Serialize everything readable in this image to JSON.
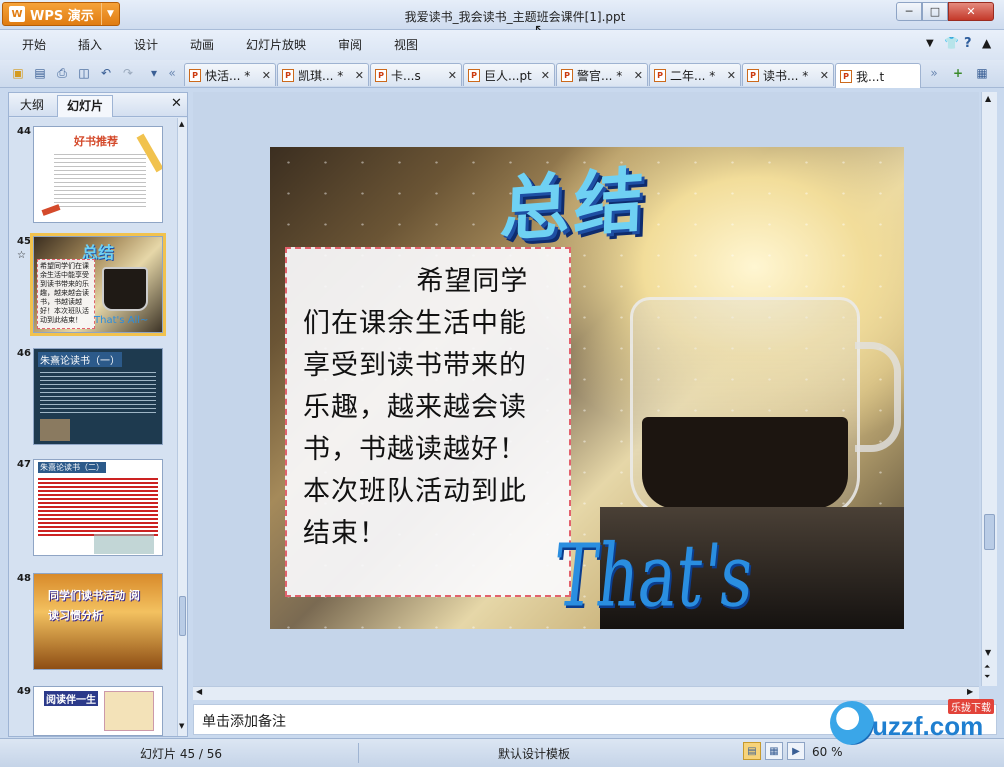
{
  "app": {
    "name": "WPS 演示",
    "title": "我爱读书_我会读书_主题班会课件[1].ppt"
  },
  "menu": [
    "开始",
    "插入",
    "设计",
    "动画",
    "幻灯片放映",
    "审阅",
    "视图"
  ],
  "tabs": [
    {
      "label": "快活... *"
    },
    {
      "label": "凯琪... *"
    },
    {
      "label": "卡...s"
    },
    {
      "label": "巨人...pt"
    },
    {
      "label": "警官... *"
    },
    {
      "label": "二年... *"
    },
    {
      "label": "读书... *"
    },
    {
      "label": "我...t"
    }
  ],
  "panel": {
    "tabs": [
      "大纲",
      "幻灯片"
    ],
    "active": "幻灯片"
  },
  "thumbnails": [
    {
      "num": "44",
      "title": "好书推荐"
    },
    {
      "num": "45",
      "title": "总结",
      "body": "希望同学们在课余生活中能享受到读书带来的乐趣，越来越会读书，书越读越好！本次班队活动到此结束！",
      "extra": "That's All~"
    },
    {
      "num": "46",
      "title": "朱熹论读书（一）"
    },
    {
      "num": "47",
      "title": "朱熹论读书（二）"
    },
    {
      "num": "48",
      "title": "同学们读书活动 阅读习惯分析"
    },
    {
      "num": "49",
      "title": "阅读伴一生"
    }
  ],
  "slide": {
    "title": "总结",
    "body": "希望同学们在课余生活中能享受到读书带来的乐趣，越来越会读书，书越读越好！本次班队活动到此结束！",
    "subtitle": "That's All~"
  },
  "notes": {
    "placeholder": "单击添加备注"
  },
  "status": {
    "slide": "幻灯片 45 / 56",
    "template": "默认设计模板",
    "zoom": "60 %"
  },
  "watermark": {
    "brand": "uzzf.com",
    "tag": "乐拢下载"
  },
  "colors": {
    "accent": "#e07c12",
    "selection": "#f1c24e",
    "title": "#6fd1f3",
    "textbox_border": "#e2626d"
  }
}
